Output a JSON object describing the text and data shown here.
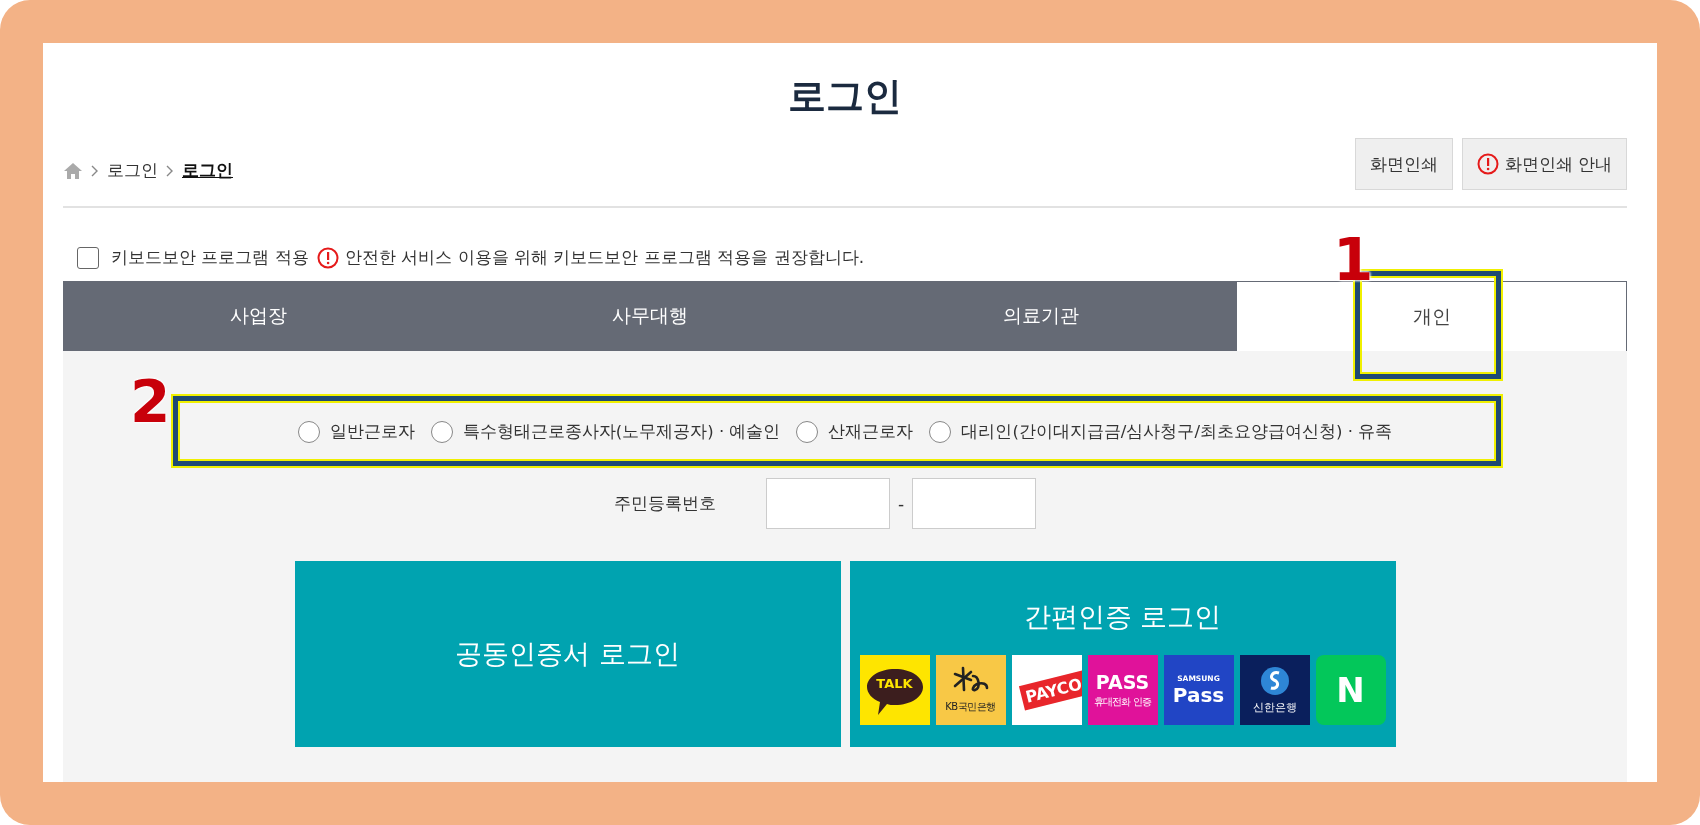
{
  "page_title": "로그인",
  "breadcrumb": [
    {
      "label": "로그인",
      "current": false
    },
    {
      "label": "로그인",
      "current": true
    }
  ],
  "buttons": [
    {
      "label": "화면인쇄",
      "kind": "plain"
    },
    {
      "label": "화면인쇄 안내",
      "kind": "info"
    }
  ],
  "keyboard_security": {
    "label": "키보드보안 프로그램 적용",
    "checked": false,
    "notice": "안전한 서비스 이용을 위해 키보드보안 프로그램 적용을 권장합니다."
  },
  "tabs": [
    {
      "label": "사업장",
      "selected": false
    },
    {
      "label": "사무대행",
      "selected": false
    },
    {
      "label": "의료기관",
      "selected": false
    },
    {
      "label": "개인",
      "selected": true
    }
  ],
  "user_types": [
    {
      "label": "일반근로자",
      "selected": false
    },
    {
      "label": "특수형태근로종사자(노무제공자) · 예술인",
      "selected": false
    },
    {
      "label": "산재근로자",
      "selected": false
    },
    {
      "label": "대리인(간이대지급금/심사청구/최초요양급여신청) · 유족",
      "selected": false
    }
  ],
  "resident_number": {
    "label": "주민등록번호",
    "separator": "-"
  },
  "login_buttons": [
    {
      "kind": "certificate",
      "label": "공동인증서 로그인"
    },
    {
      "kind": "simple",
      "label": "간편인증 로그인",
      "providers": [
        {
          "kind": "kakao",
          "texts": [
            "TALK"
          ]
        },
        {
          "kind": "kb",
          "texts": [
            "KB국민은행"
          ]
        },
        {
          "kind": "payco",
          "texts": [
            "PAYCO"
          ]
        },
        {
          "kind": "pass",
          "texts": [
            "PASS",
            "휴대전화 인증"
          ]
        },
        {
          "kind": "samsung",
          "texts": [
            "SAMSUNG",
            "Pass"
          ]
        },
        {
          "kind": "shinhan",
          "texts": [
            "신한은행"
          ]
        },
        {
          "kind": "naver",
          "texts": [
            "N"
          ]
        }
      ]
    }
  ],
  "annotations": [
    {
      "label": "1"
    },
    {
      "label": "2"
    }
  ]
}
